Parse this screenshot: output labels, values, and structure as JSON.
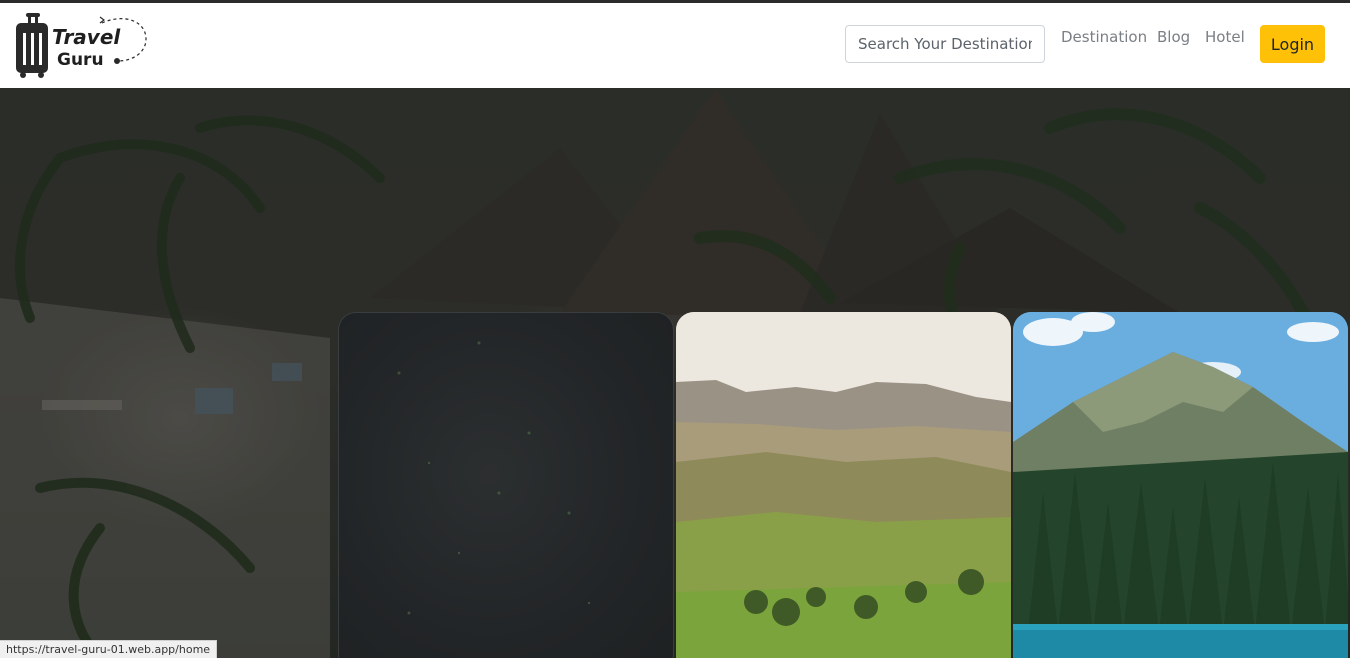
{
  "header": {
    "logo": {
      "line1": "Travel",
      "line2": "Guru"
    },
    "search": {
      "placeholder": "Search Your Destination",
      "value": ""
    },
    "nav": [
      "Destination",
      "Blog",
      "Hotel"
    ],
    "login_label": "Login"
  },
  "cards": [
    {
      "name": "dark card"
    },
    {
      "name": "hills card"
    },
    {
      "name": "mountain lake card"
    }
  ],
  "status_bar": {
    "url": "https://travel-guru-01.web.app/home"
  },
  "colors": {
    "accent": "#ffc107",
    "nav_text": "#7a7f85",
    "navbar_bg": "#ffffff"
  },
  "icons": [
    "suitcase-icon"
  ]
}
